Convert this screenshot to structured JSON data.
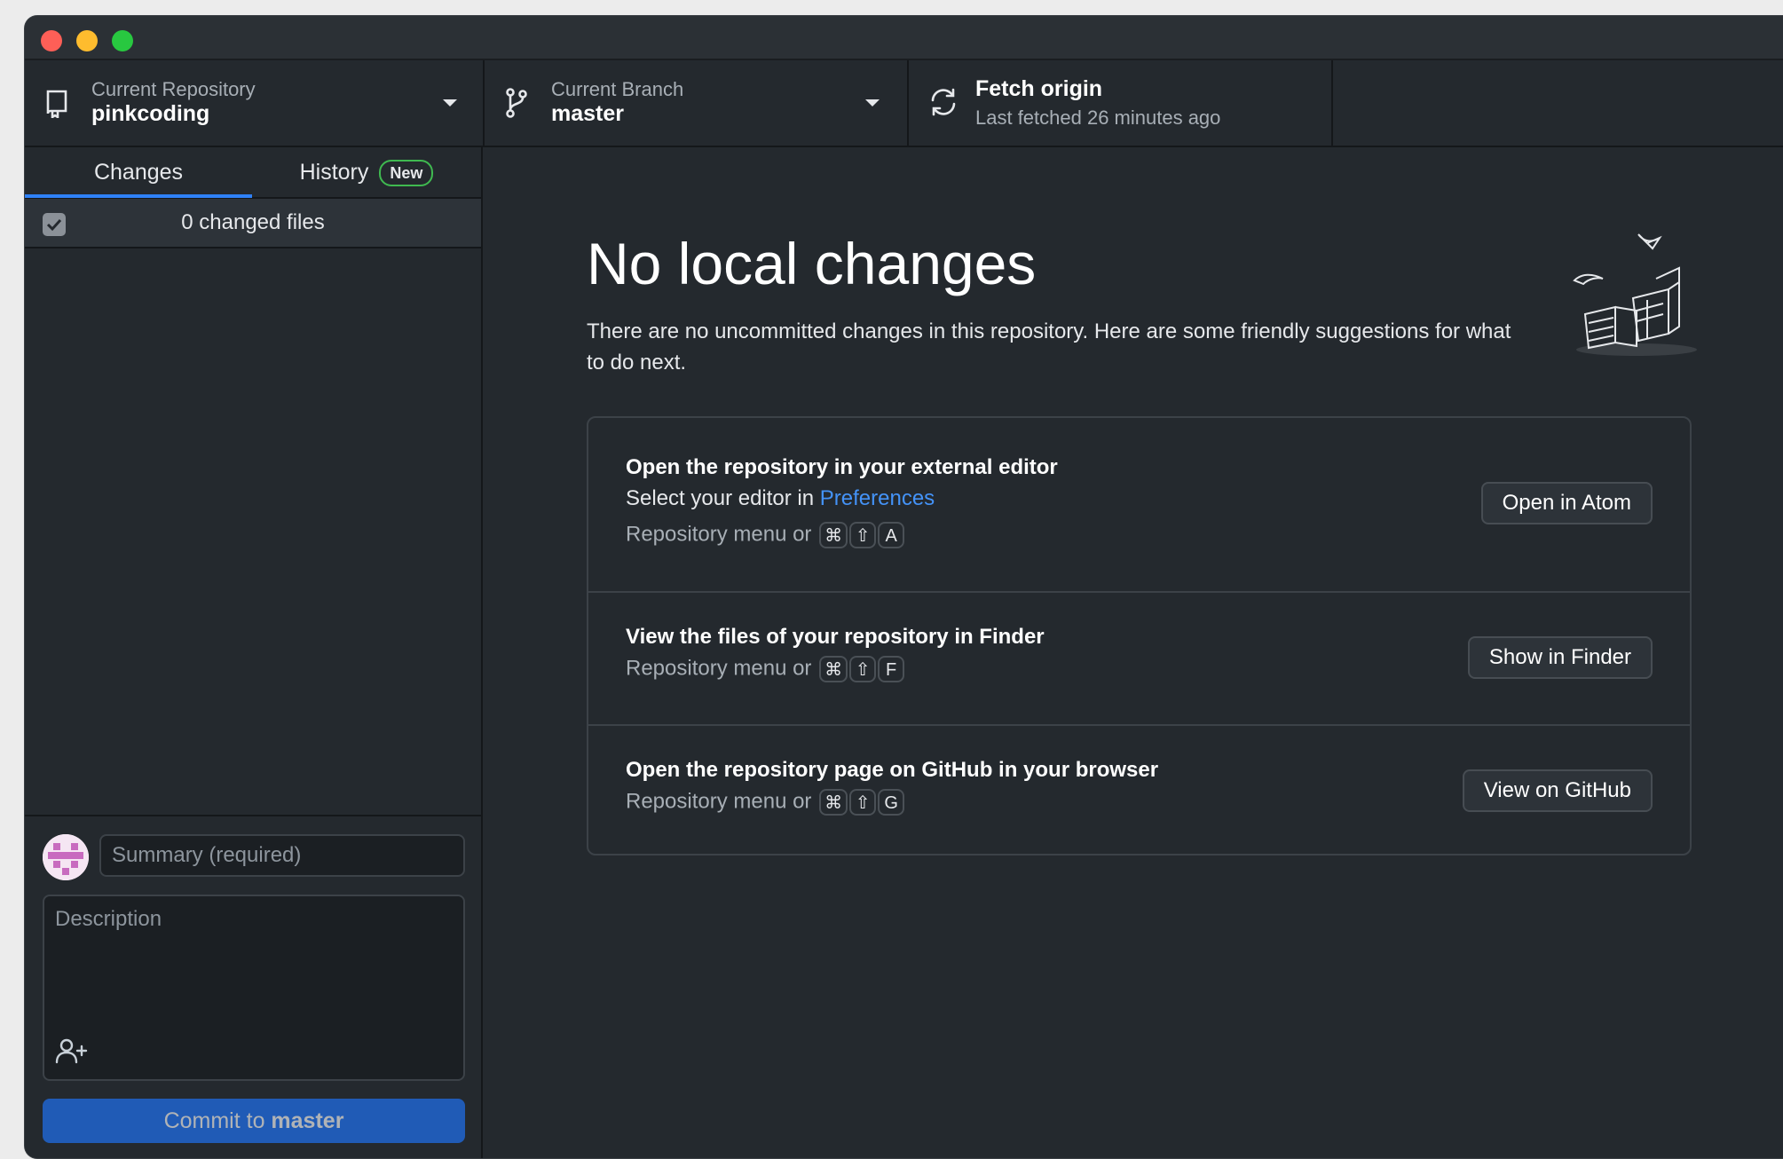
{
  "colors": {
    "accent": "#2f81f7",
    "link": "#4493f8",
    "badge": "#3fb950",
    "background": "#24292e"
  },
  "toolbar": {
    "repository": {
      "label": "Current Repository",
      "value": "pinkcoding",
      "icon": "repo-icon"
    },
    "branch": {
      "label": "Current Branch",
      "value": "master",
      "icon": "branch-icon"
    },
    "fetch": {
      "title": "Fetch origin",
      "subtitle": "Last fetched 26 minutes ago",
      "icon": "sync-icon"
    }
  },
  "sidebar": {
    "tabs": [
      {
        "label": "Changes",
        "active": true
      },
      {
        "label": "History",
        "badge": "New"
      }
    ],
    "changed_files_label": "0 changed files",
    "commit": {
      "summary_placeholder": "Summary (required)",
      "description_placeholder": "Description",
      "button_prefix": "Commit to ",
      "button_branch": "master"
    }
  },
  "main": {
    "title": "No local changes",
    "subtitle": "There are no uncommitted changes in this repository. Here are some friendly suggestions for what to do next.",
    "cards": [
      {
        "title": "Open the repository in your external editor",
        "line_prefix": "Select your editor in ",
        "line_link": "Preferences",
        "hint": "Repository menu or",
        "keys": [
          "⌘",
          "⇧",
          "A"
        ],
        "button": "Open in Atom"
      },
      {
        "title": "View the files of your repository in Finder",
        "hint": "Repository menu or",
        "keys": [
          "⌘",
          "⇧",
          "F"
        ],
        "button": "Show in Finder"
      },
      {
        "title": "Open the repository page on GitHub in your browser",
        "hint": "Repository menu or",
        "keys": [
          "⌘",
          "⇧",
          "G"
        ],
        "button": "View on GitHub"
      }
    ]
  }
}
